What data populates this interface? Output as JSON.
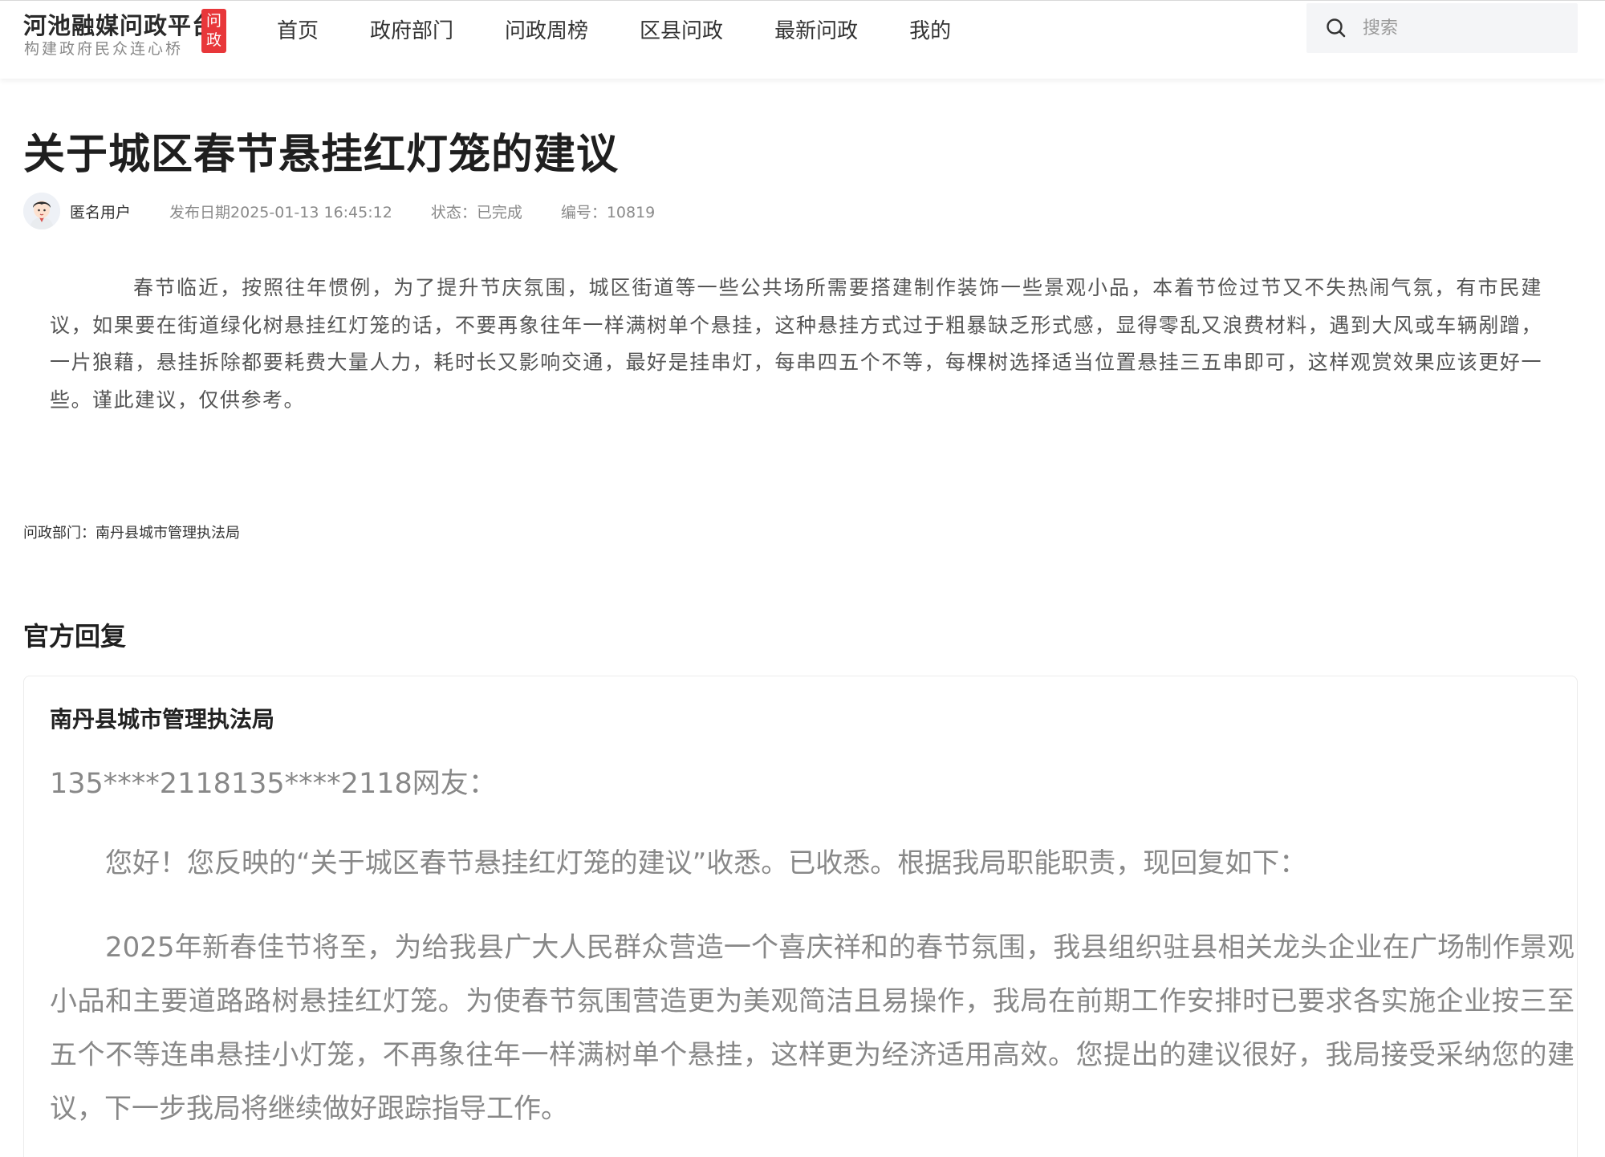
{
  "header": {
    "logo_title": "河池融媒问政平台",
    "logo_subtitle": "构建政府民众连心桥",
    "logo_badge": "问政",
    "nav": [
      "首页",
      "政府部门",
      "问政周榜",
      "区县问政",
      "最新问政",
      "我的"
    ],
    "search_placeholder": "搜索"
  },
  "article": {
    "title": "关于城区春节悬挂红灯笼的建议",
    "author": "匿名用户",
    "date": "发布日期2025-01-13 16:45:12",
    "status": "状态：已完成",
    "number": "编号：10819",
    "body": "春节临近，按照往年惯例，为了提升节庆氛围，城区街道等一些公共场所需要搭建制作装饰一些景观小品，本着节俭过节又不失热闹气氛，有市民建议，如果要在街道绿化树悬挂红灯笼的话，不要再象往年一样满树单个悬挂，这种悬挂方式过于粗暴缺乏形式感，显得零乱又浪费材料，遇到大风或车辆剐蹭，一片狼藉，悬挂拆除都要耗费大量人力，耗时长又影响交通，最好是挂串灯，每串四五个不等，每棵树选择适当位置悬挂三五串即可，这样观赏效果应该更好一些。谨此建议，仅供参考。",
    "department": "问政部门：南丹县城市管理执法局"
  },
  "reply": {
    "heading": "官方回复",
    "org": "南丹县城市管理执法局",
    "greeting": "135****2118135****2118网友：",
    "para1": "您好！您反映的“关于城区春节悬挂红灯笼的建议”收悉。已收悉。根据我局职能职责，现回复如下：",
    "para2": "2025年新春佳节将至，为给我县广大人民群众营造一个喜庆祥和的春节氛围，我县组织驻县相关龙头企业在广场制作景观小品和主要道路路树悬挂红灯笼。为使春节氛围营造更为美观简洁且易操作，我局在前期工作安排时已要求各实施企业按三至五个不等连串悬挂小灯笼，不再象往年一样满树单个悬挂，这样更为经济适用高效。您提出的建议很好，我局接受采纳您的建议，下一步我局将继续做好跟踪指导工作。"
  },
  "colors": {
    "badge": "#e8373a",
    "search_bg": "#f4f5f7"
  },
  "icons": [
    "search-icon",
    "avatar-icon"
  ]
}
